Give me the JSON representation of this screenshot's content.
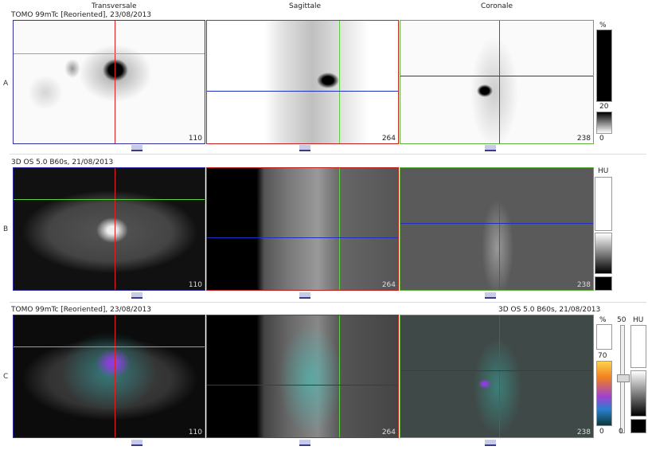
{
  "columns": {
    "transversale": "Transversale",
    "sagittale": "Sagittale",
    "coronale": "Coronale"
  },
  "rows": {
    "a": {
      "label": "A",
      "series": "TOMO 99mTc [Reoriented], 23/08/2013"
    },
    "b": {
      "label": "B",
      "series": "3D  OS  5.0  B60s, 21/08/2013"
    },
    "c": {
      "label": "C",
      "series_left": "TOMO 99mTc [Reoriented], 23/08/2013",
      "series_right": "3D  OS  5.0  B60s, 21/08/2013"
    }
  },
  "slices": {
    "transversale": "110",
    "sagittale": "264",
    "coronale": "238"
  },
  "scales": {
    "a": {
      "unit": "%",
      "upper": "20",
      "lower": "0"
    },
    "b": {
      "unit": "HU"
    },
    "c": {
      "unit_pct": "%",
      "upper": "70",
      "lower": "0",
      "window": "50",
      "unit_hu": "HU",
      "hu_lower": "0"
    }
  },
  "colors": {
    "crosshair_red": "#e02020",
    "crosshair_green": "#60d040",
    "crosshair_blue": "#2030c0",
    "border_transversale": "#3030a0",
    "border_sagittale": "#c02020",
    "border_coronale": "#60b040"
  }
}
